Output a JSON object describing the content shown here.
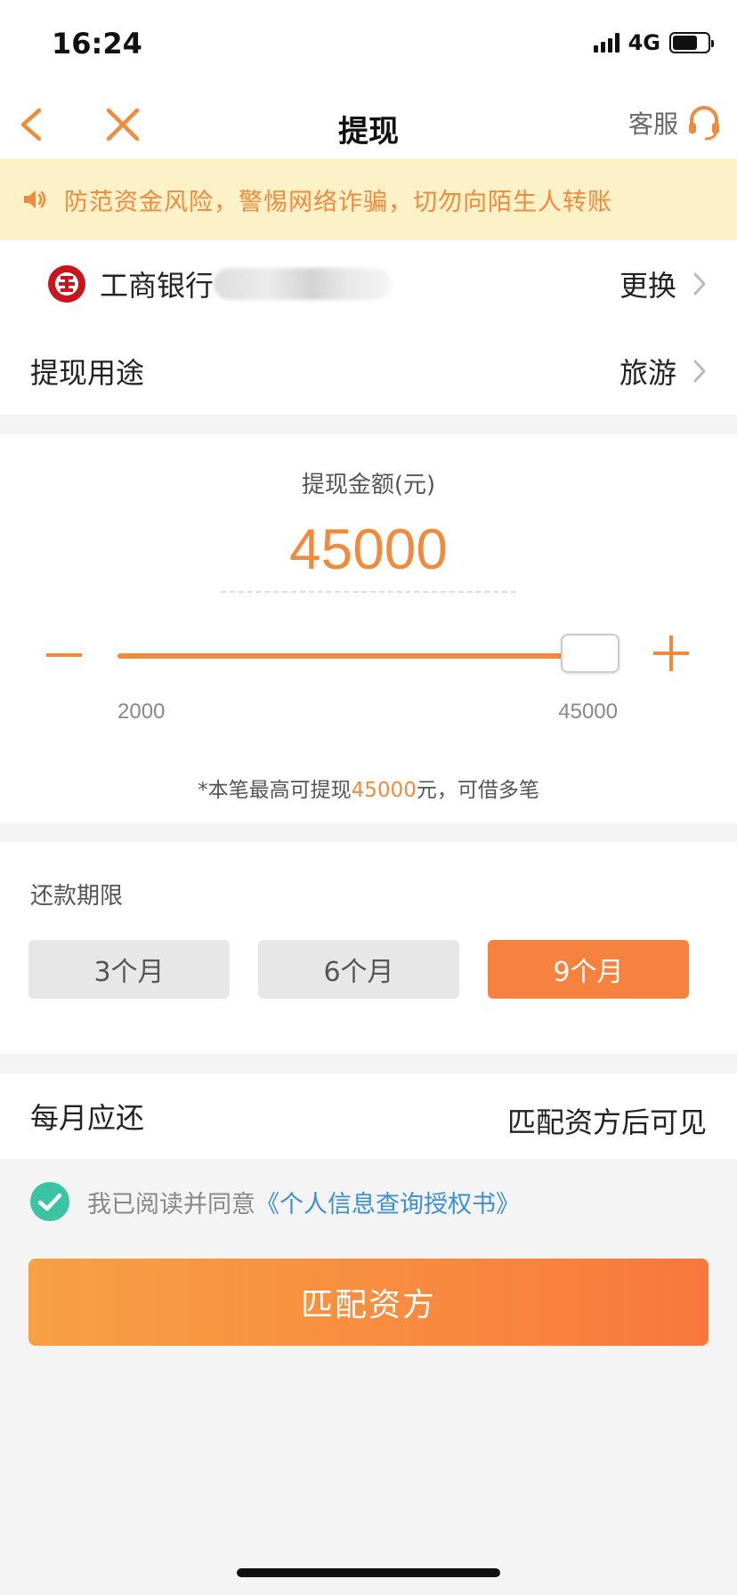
{
  "status_bar": {
    "time": "16:24",
    "network": "4G"
  },
  "nav": {
    "title": "提现",
    "service_label": "客服"
  },
  "notice": {
    "text": "防范资金风险，警惕网络诈骗，切勿向陌生人转账"
  },
  "bank": {
    "name": "工商银行",
    "change_label": "更换"
  },
  "purpose": {
    "label": "提现用途",
    "value": "旅游"
  },
  "amount": {
    "label": "提现金额(元)",
    "value": "45000",
    "slider_min": "2000",
    "slider_max": "45000",
    "slider_fraction": 1.0,
    "note_prefix": "*本笔最高可提现",
    "note_amount": "45000",
    "note_suffix": "元，可借多笔"
  },
  "term": {
    "label": "还款期限",
    "options": [
      "3个月",
      "6个月",
      "9个月"
    ],
    "selected_index": 2
  },
  "monthly": {
    "label": "每月应还",
    "value": "匹配资方后可见"
  },
  "agreement": {
    "text": "我已阅读并同意",
    "link": "《个人信息查询授权书》",
    "checked": true
  },
  "submit": {
    "label": "匹配资方"
  },
  "colors": {
    "accent": "#f08a3c",
    "button": "#f7823f",
    "link": "#3c8fd4",
    "notice_bg": "#fdf1c7",
    "check": "#3cc3a4"
  }
}
